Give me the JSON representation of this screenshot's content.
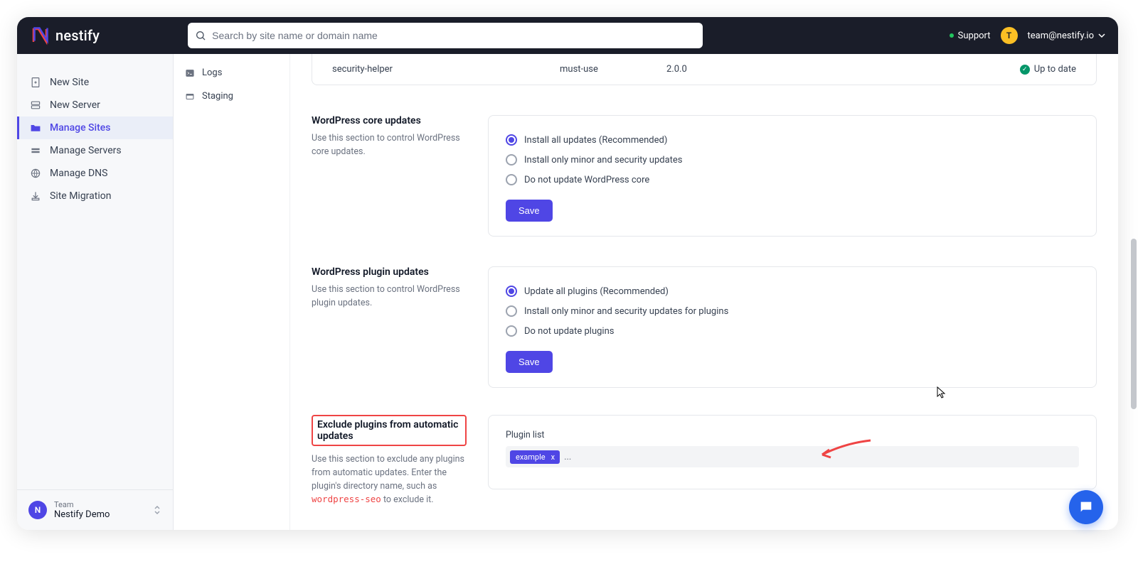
{
  "brand": {
    "name": "nestify"
  },
  "search": {
    "placeholder": "Search by site name or domain name"
  },
  "header": {
    "support": "Support",
    "avatar_letter": "T",
    "email": "team@nestify.io"
  },
  "nav": {
    "items": [
      {
        "label": "New Site",
        "icon": "file-plus"
      },
      {
        "label": "New Server",
        "icon": "server-stack"
      },
      {
        "label": "Manage Sites",
        "icon": "folder",
        "active": true
      },
      {
        "label": "Manage Servers",
        "icon": "servers"
      },
      {
        "label": "Manage DNS",
        "icon": "globe"
      },
      {
        "label": "Site Migration",
        "icon": "migrate"
      }
    ]
  },
  "team": {
    "label": "Team",
    "name": "Nestify Demo",
    "avatar_letter": "N"
  },
  "subnav": [
    {
      "label": "Logs",
      "icon": "terminal"
    },
    {
      "label": "Staging",
      "icon": "staging"
    }
  ],
  "plugin_row": {
    "name": "security-helper",
    "type": "must-use",
    "version": "2.0.0",
    "status": "Up to date"
  },
  "core_updates": {
    "title": "WordPress core updates",
    "desc": "Use this section to control WordPress core updates.",
    "options": [
      "Install all updates (Recommended)",
      "Install only minor and security updates",
      "Do not update WordPress core"
    ],
    "selected": 0,
    "save": "Save"
  },
  "plugin_updates": {
    "title": "WordPress plugin updates",
    "desc": "Use this section to control WordPress plugin updates.",
    "options": [
      "Update all plugins (Recommended)",
      "Install only minor and security updates for plugins",
      "Do not update plugins"
    ],
    "selected": 0,
    "save": "Save"
  },
  "exclude": {
    "title": "Exclude plugins from automatic updates",
    "desc_pre": "Use this section to exclude any plugins from automatic updates. Enter the plugin's directory name, such as ",
    "desc_code": "wordpress-seo",
    "desc_post": " to exclude it.",
    "list_label": "Plugin list",
    "tag": "example"
  }
}
